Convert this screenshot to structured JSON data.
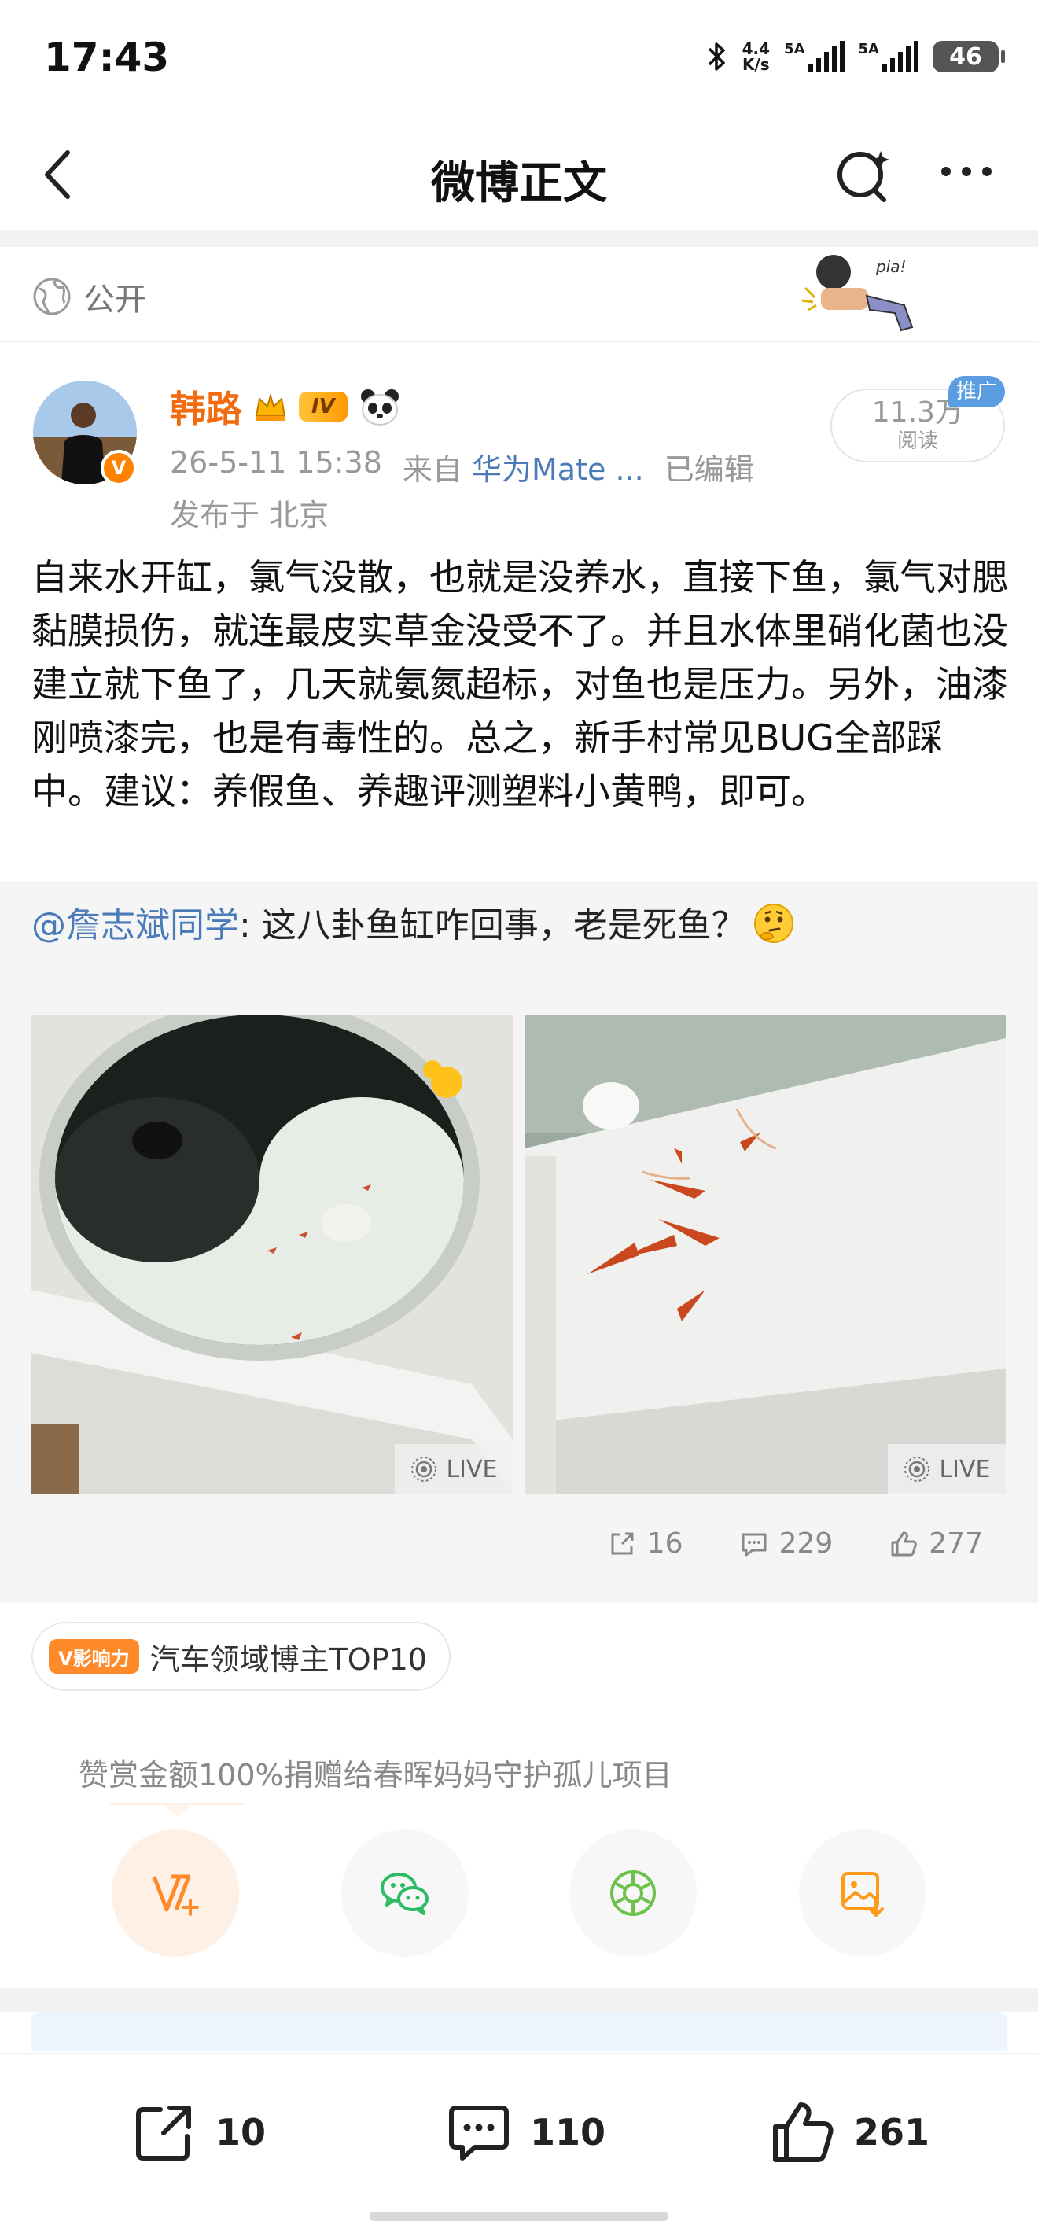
{
  "status_bar": {
    "time": "17:43",
    "net_speed_value": "4.4",
    "net_speed_unit": "K/s",
    "sim1_label": "5A",
    "sim2_label": "5A",
    "battery": "46",
    "icons": [
      "bluetooth-icon",
      "signal-icon",
      "battery-icon"
    ]
  },
  "nav": {
    "title": "微博正文",
    "icons": [
      "back-icon",
      "search-icon",
      "more-icon"
    ]
  },
  "visibility": {
    "label": "公开",
    "icon": "globe-icon"
  },
  "post": {
    "author": "韩路",
    "level_badge": "IV",
    "timestamp": "26-5-11 15:38",
    "source_prefix": "来自",
    "source_device": "华为Mate ...",
    "edited": "已编辑",
    "location": "发布于 北京",
    "read_count": "11.3万",
    "read_label": "阅读",
    "ad_badge": "推广",
    "text": "自来水开缸，氯气没散，也就是没养水，直接下鱼，氯气对腮黏膜损伤，就连最皮实草金没受不了。并且水体里硝化菌也没建立就下鱼了，几天就氨氮超标，对鱼也是压力。另外，油漆刚喷漆完，也是有毒性的。总之，新手村常见BUG全部踩中。建议：养假鱼、养趣评测塑料小黄鸭，即可。"
  },
  "repost": {
    "author": "@詹志斌同学",
    "text": ": 这八卦鱼缸咋回事，老是死鱼？",
    "live_label": "LIVE",
    "shares": "16",
    "comments": "229",
    "likes": "277"
  },
  "influence": {
    "tag": "V影响力",
    "text": "汽车领域博主TOP10"
  },
  "reward": {
    "text": "赞赏金额100%捐赠给春晖妈妈守护孤儿项目",
    "buttons": [
      "reward-icon",
      "wechat-icon",
      "moments-icon",
      "save-image-icon"
    ]
  },
  "bottom_bar": {
    "shares": "10",
    "comments": "110",
    "likes": "261"
  },
  "colors": {
    "brand_orange": "#f26b11",
    "link_blue": "#4a7bb8",
    "ad_blue": "#5a9de0",
    "wechat_green": "#2dbb63",
    "moments_green": "#6cc24a"
  }
}
